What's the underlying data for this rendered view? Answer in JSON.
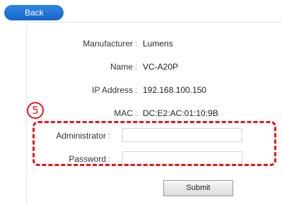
{
  "header": {
    "back_label": "Back"
  },
  "info": {
    "manufacturer_label": "Manufacturer",
    "manufacturer_value": "Lumens",
    "name_label": "Name",
    "name_value": "VC-A20P",
    "ip_label": "IP Address",
    "ip_value": "192.168.100.150",
    "mac_label": "MAC",
    "mac_value": "DC:E2:AC:01:10:9B",
    "separator": ":"
  },
  "login": {
    "administrator_label": "Administrator",
    "administrator_value": "",
    "password_label": "Password",
    "password_value": ""
  },
  "actions": {
    "submit_label": "Submit"
  },
  "annotation": {
    "step_number": "5",
    "color": "#e8141b"
  },
  "colors": {
    "back_button": "#1f77d8"
  }
}
